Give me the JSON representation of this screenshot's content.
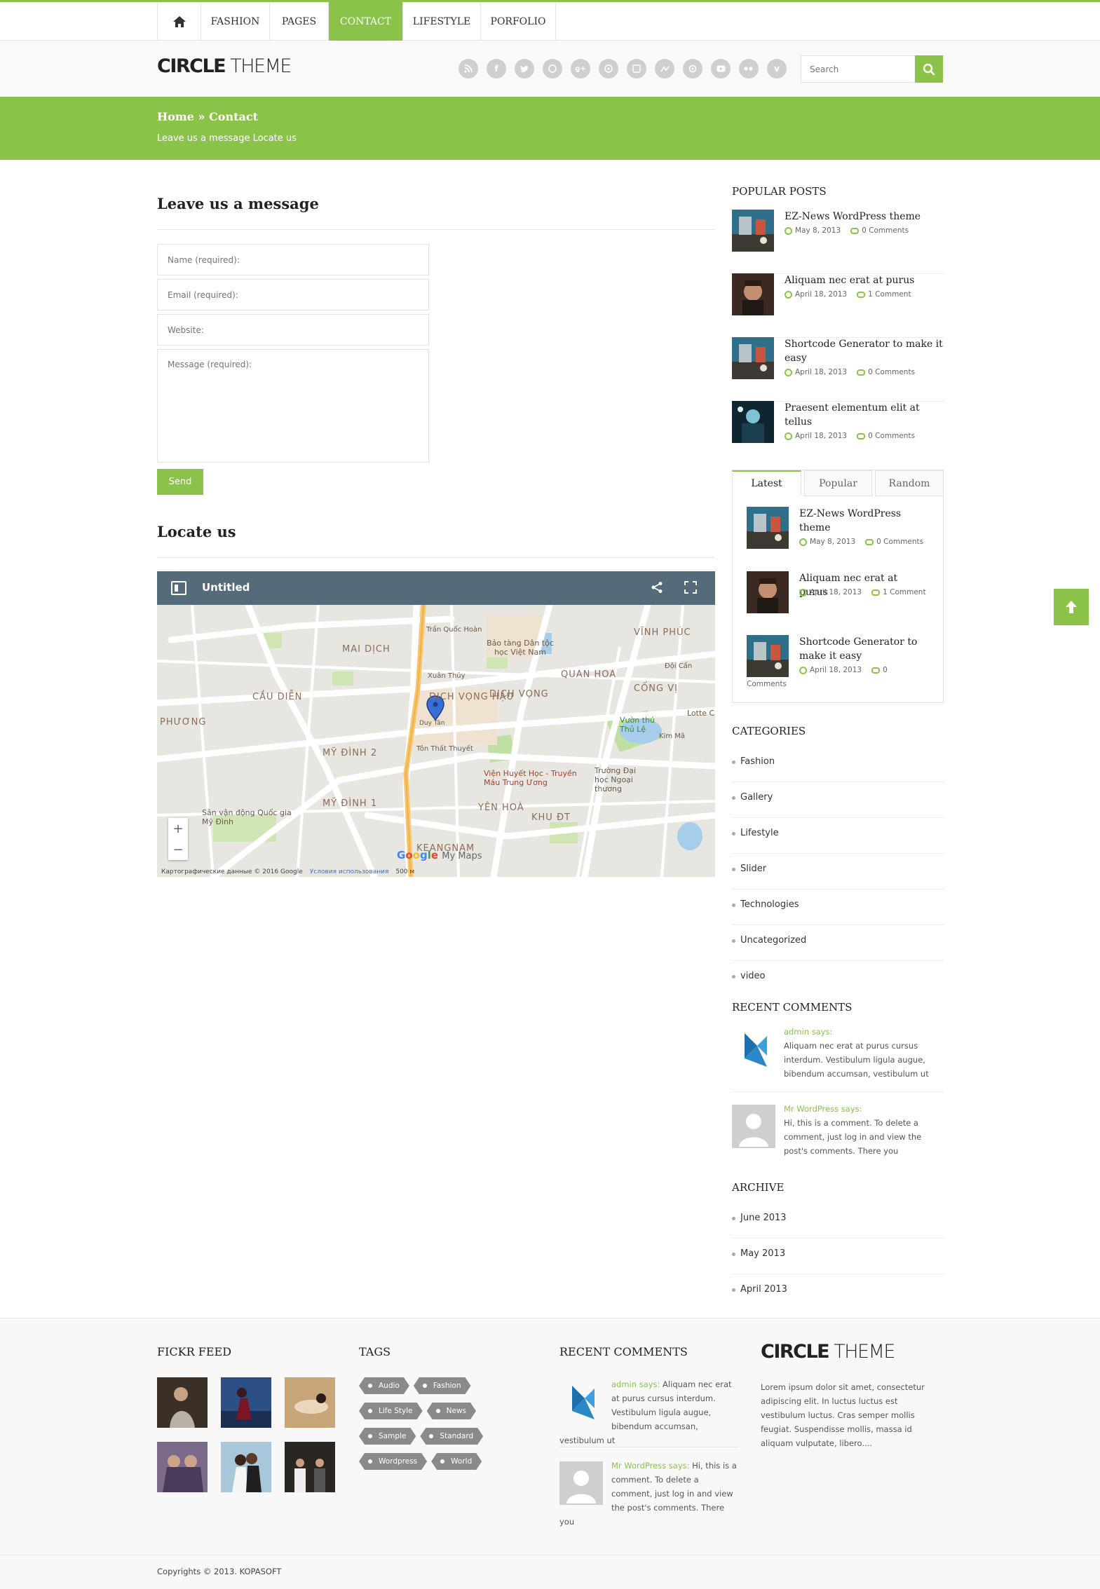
{
  "nav": {
    "items": [
      "FASHION",
      "PAGES",
      "CONTACT",
      "LIFESTYLE",
      "PORFOLIO"
    ],
    "active": "CONTACT",
    "home_icon": "home-icon"
  },
  "header": {
    "logo_bold": "CIRCLE",
    "logo_light": " THEME",
    "social_icons": [
      "rss-icon",
      "facebook-icon",
      "twitter-icon",
      "dribbble-icon",
      "google-plus-icon",
      "pinterest-icon",
      "linkedin-icon",
      "skype-icon",
      "instagram-icon",
      "youtube-icon",
      "flickr-icon",
      "vimeo-icon"
    ],
    "search_placeholder": "Search"
  },
  "banner": {
    "breadcrumb": "Home » Contact",
    "subtitle": "Leave us a message Locate us"
  },
  "contact": {
    "title": "Leave us a message",
    "name_placeholder": "Name (required):",
    "email_placeholder": "Email (required):",
    "website_placeholder": "Website:",
    "message_placeholder": "Message (required):",
    "send_label": "Send"
  },
  "map": {
    "section_title": "Locate us",
    "title": "Untitled",
    "attribution": "Картографические данные © 2016 Google",
    "terms": "Условия использования",
    "scale": "500 м",
    "brand": "My Maps",
    "labels": [
      "MAI DỊCH",
      "CẦU DIỄN",
      "PHƯƠNG",
      "MỸ ĐÌNH 2",
      "MỸ ĐÌNH 1",
      "DỊCH VỌNG HẬU",
      "DỊCH VỌNG",
      "QUAN HOA",
      "CỐNG VỊ",
      "VĨNH PHÚC",
      "YÊN HOÀ",
      "KHU ĐT",
      "KEANGNAM",
      "Bảo tàng Dân tộc học Việt Nam",
      "Viện Huyết Học - Truyền Máu Trung Ương",
      "Trường Đại học Ngoại thương",
      "Sân vận động Quốc gia Mỹ Đình",
      "Vườn thú Thủ Lệ",
      "Lotte C",
      "Trần Quốc Hoàn",
      "Xuân Thủy",
      "Tôn Thất Thuyết",
      "Duy Tân",
      "Kim Mã",
      "Đội Cấn"
    ]
  },
  "popular_posts": {
    "title": "POPULAR POSTS",
    "items": [
      {
        "title": "EZ-News WordPress theme",
        "date": "May 8, 2013",
        "comments": "0 Comments"
      },
      {
        "title": "Aliquam nec erat at purus",
        "date": "April 18, 2013",
        "comments": "1 Comment"
      },
      {
        "title": "Shortcode Generator to make it easy",
        "date": "April 18, 2013",
        "comments": "0 Comments"
      },
      {
        "title": "Praesent elementum elit at tellus",
        "date": "April 18, 2013",
        "comments": "0 Comments"
      }
    ]
  },
  "tabs": {
    "labels": [
      "Latest",
      "Popular",
      "Random"
    ],
    "active": "Latest",
    "items": [
      {
        "title": "EZ-News WordPress theme",
        "date": "May 8, 2013",
        "comments": "0 Comments"
      },
      {
        "title": "Aliquam nec erat at purus",
        "date": "April 18, 2013",
        "comments": "1 Comment"
      },
      {
        "title": "Shortcode Generator to make it easy",
        "date": "April 18, 2013",
        "comments": "0",
        "comments_wrap": "Comments"
      }
    ]
  },
  "categories": {
    "title": "CATEGORIES",
    "items": [
      "Fashion",
      "Gallery",
      "Lifestyle",
      "Slider",
      "Technologies",
      "Uncategorized",
      "video"
    ]
  },
  "recent_comments": {
    "title": "RECENT COMMENTS",
    "items": [
      {
        "author": "admin says:",
        "text": "Aliquam nec erat at purus cursus interdum. Vestibulum ligula augue, bibendum accumsan, vestibulum ut"
      },
      {
        "author": "Mr WordPress says:",
        "text": "Hi, this is a comment. To delete a comment, just log in and view the post's comments. There you"
      }
    ]
  },
  "archive": {
    "title": "ARCHIVE",
    "items": [
      "June 2013",
      "May 2013",
      "April 2013"
    ]
  },
  "footer": {
    "flickr_title": "FICKR FEED",
    "tags_title": "TAGS",
    "tags": [
      "Audio",
      "Fashion",
      "Life Style",
      "News",
      "Sample",
      "Standard",
      "Wordpress",
      "World"
    ],
    "comments_title": "RECENT COMMENTS",
    "comments": [
      {
        "author": "admin says:",
        "text": " Aliquam nec erat at purus cursus interdum. Vestibulum ligula augue, bibendum accumsan, vestibulum ut"
      },
      {
        "author": "Mr WordPress says:",
        "text": " Hi, this is a comment. To delete a comment, just log in and view the post's comments. There you"
      }
    ],
    "logo_bold": "CIRCLE",
    "logo_light": " THEME",
    "about": "Lorem ipsum dolor sit amet, consectetur adipiscing elit. In luctus luctus est vestibulum luctus. Cras semper mollis feugiat. Suspendisse mollis, massa id aliquam vulputate, libero....",
    "copyright": "Copyrights © 2013. KOPASOFT"
  },
  "colors": {
    "accent": "#8bc34a",
    "map_bar": "#556b7a"
  }
}
